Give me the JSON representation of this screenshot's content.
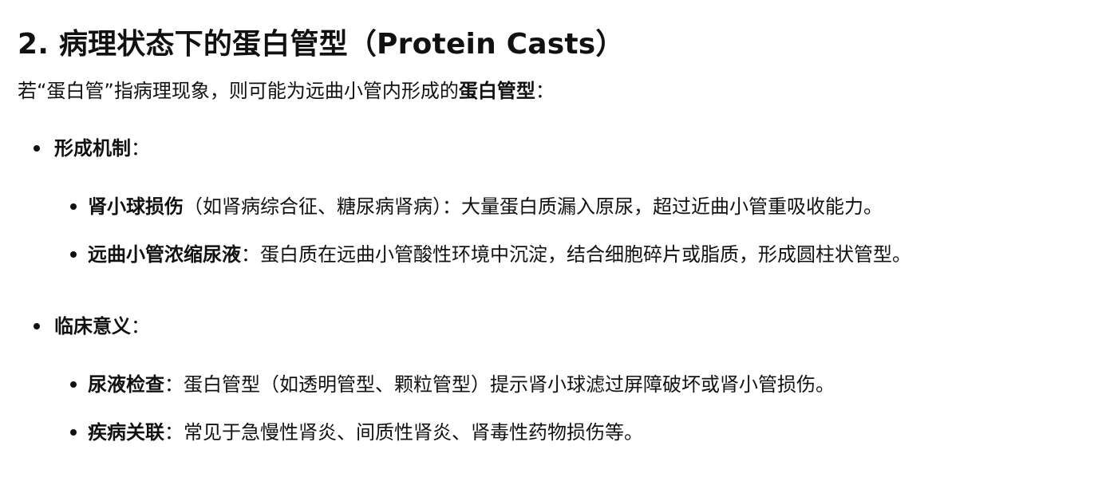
{
  "section": {
    "heading": "2. 病理状态下的蛋白管型（Protein Casts）",
    "intro_prefix": "若“蛋白管”指病理现象，则可能为远曲小管内形成的",
    "intro_bold": "蛋白管型",
    "intro_suffix": "："
  },
  "groups": [
    {
      "label": "形成机制",
      "label_suffix": "：",
      "items": [
        {
          "term": "肾小球损伤",
          "text": "（如肾病综合征、糖尿病肾病）：大量蛋白质漏入原尿，超过近曲小管重吸收能力。"
        },
        {
          "term": "远曲小管浓缩尿液",
          "text": "：蛋白质在远曲小管酸性环境中沉淀，结合细胞碎片或脂质，形成圆柱状管型。"
        }
      ]
    },
    {
      "label": "临床意义",
      "label_suffix": "：",
      "items": [
        {
          "term": "尿液检查",
          "text": "：蛋白管型（如透明管型、颗粒管型）提示肾小球滤过屏障破坏或肾小管损伤。"
        },
        {
          "term": "疾病关联",
          "text": "：常见于急慢性肾炎、间质性肾炎、肾毒性药物损伤等。"
        }
      ]
    }
  ]
}
